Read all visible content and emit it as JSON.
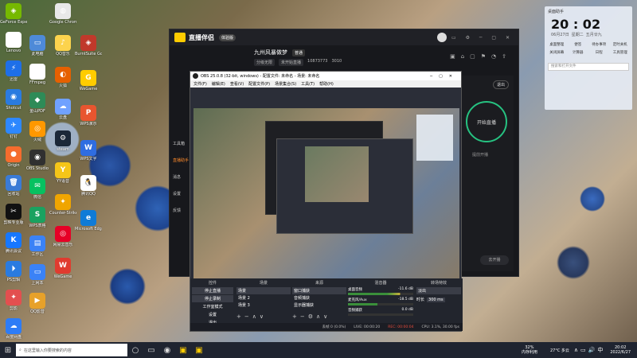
{
  "desktop": {
    "icons": [
      {
        "label": "GeForce Experience",
        "glyph": "◈",
        "bg": "#76b900"
      },
      {
        "label": "Lenovo",
        "glyph": "▣",
        "bg": "#ffffff"
      },
      {
        "label": "迅雷",
        "glyph": "⚡",
        "bg": "#1e6fe8"
      },
      {
        "label": "Shotcut",
        "glyph": "◉",
        "bg": "#2a7be0"
      },
      {
        "label": "钉钉",
        "glyph": "✈",
        "bg": "#2d88ff"
      },
      {
        "label": "Origin",
        "glyph": "●",
        "bg": "#f56c2d"
      },
      {
        "label": "回收站",
        "glyph": "🗑",
        "bg": "#3a7bd5"
      },
      {
        "label": "剪映专业版",
        "glyph": "✂",
        "bg": "#111111"
      },
      {
        "label": "腾讯会议",
        "glyph": "K",
        "bg": "#1677ff"
      },
      {
        "label": "PS剪辑",
        "glyph": "⏵",
        "bg": "#2a7be0"
      },
      {
        "label": "剪影",
        "glyph": "✦",
        "bg": "#e34f4f"
      },
      {
        "label": "百度网盘",
        "glyph": "☁",
        "bg": "#2d7cf6"
      }
    ],
    "icons_col2": [
      {
        "label": "此电脑",
        "glyph": "▭",
        "bg": "#4e8ad8"
      },
      {
        "label": "FFmpeg",
        "glyph": "▲",
        "bg": "#ffffff"
      },
      {
        "label": "金山PDF",
        "glyph": "◆",
        "bg": "#2e8b57"
      },
      {
        "label": "火绒",
        "glyph": "◎",
        "bg": "#ff9800"
      },
      {
        "label": "OBS Studio",
        "glyph": "◉",
        "bg": "#303030"
      },
      {
        "label": "微信",
        "glyph": "✉",
        "bg": "#07c160"
      },
      {
        "label": "WPS表格",
        "glyph": "S",
        "bg": "#1aa260"
      },
      {
        "label": "工作区",
        "glyph": "▤",
        "bg": "#3b82f6"
      },
      {
        "label": "上网本",
        "glyph": "▭",
        "bg": "#3b82f6"
      },
      {
        "label": "QQ影音",
        "glyph": "▶",
        "bg": "#e7a12a"
      }
    ],
    "icons_col3": [
      {
        "label": "Google Chrome",
        "glyph": "◍",
        "bg": "#e8e8e8"
      },
      {
        "label": "QQ音乐",
        "glyph": "♪",
        "bg": "#fcd34d"
      },
      {
        "label": "火狐",
        "glyph": "◐",
        "bg": "#e66000"
      },
      {
        "label": "云盘",
        "glyph": "☁",
        "bg": "#70a1ff"
      },
      {
        "label": "steam",
        "glyph": "⚙",
        "bg": "#1b2838"
      },
      {
        "label": "YY语音",
        "glyph": "Y",
        "bg": "#f5c518"
      },
      {
        "label": "Counter-Strike Global Offensive",
        "glyph": "✦",
        "bg": "#f0a500"
      },
      {
        "label": "网易云音乐",
        "glyph": "◎",
        "bg": "#e60026"
      },
      {
        "label": "WeGame",
        "glyph": "W",
        "bg": "#e03b2f"
      }
    ],
    "icons_col4": [
      {
        "label": "BurntSuite Go",
        "glyph": "◈",
        "bg": "#c0392b"
      },
      {
        "label": "WeGame",
        "glyph": "G",
        "bg": "#ffcc00"
      },
      {
        "label": "WPS演示",
        "glyph": "P",
        "bg": "#e8552f"
      },
      {
        "label": "WPS文字",
        "glyph": "W",
        "bg": "#2f6de1"
      },
      {
        "label": "腾讯QQ",
        "glyph": "🐧",
        "bg": "#ffffff"
      },
      {
        "label": "Microsoft Edge",
        "glyph": "e",
        "bg": "#0f7bd7"
      }
    ]
  },
  "live_app": {
    "name": "直播伴侣",
    "badge": "体验版",
    "title": "九州风暴做梦",
    "tag": "普通",
    "sub1": "分级无限",
    "sub2": "未开始直播",
    "stat1": "10873773",
    "stat2": "3010",
    "side_labels": [
      "工具箱",
      "直播助手",
      "消息",
      "设置",
      "反馈"
    ],
    "cta_label": "开始直播",
    "sub_label": "提前开播"
  },
  "obs": {
    "window_title": "OBS 25.0.8 (32-bit, windows) - 配置文件: 未命名 - 场景: 未命名",
    "menu": [
      "文件(F)",
      "编辑(E)",
      "查看(V)",
      "配置文件(P)",
      "场景集合(S)",
      "工具(T)",
      "帮助(H)"
    ],
    "panels": {
      "controls_title": "控件",
      "scenes_title": "场景",
      "sources_title": "来源",
      "mixer_title": "混音器",
      "transitions_title": "转场特效"
    },
    "controls": [
      "停止直播",
      "停止录制",
      "工作室模式",
      "设置",
      "退出"
    ],
    "scenes": [
      "场景",
      "场景 2",
      "场景 3"
    ],
    "sources": [
      "窗口捕获",
      "音频捕获",
      "显示器捕获"
    ],
    "mixer": [
      {
        "name": "桌面音频",
        "db": "-11.6 dB"
      },
      {
        "name": "麦克风/Aux",
        "db": "-18.5 dB"
      },
      {
        "name": "音频捕获",
        "db": "0.0 dB"
      }
    ],
    "transition": "淡出",
    "duration_label": "时长",
    "duration": "300 ms",
    "status": {
      "dropped": "丢帧 0 (0.0%)",
      "live": "LIVE: 00:00:20",
      "rec": "REC: 00:00:04",
      "cpu": "CPU: 3.1%, 30.00 fps"
    }
  },
  "clock": {
    "time": "20 : 02",
    "date": "06月27日",
    "weekday": "星期二",
    "lunar": "五月廿九",
    "items": [
      "桌面整理",
      "便签",
      "待办事项",
      "定时关机",
      "关闭屏幕",
      "计算器",
      "日程",
      "工具管理"
    ],
    "search_placeholder": "搜索和打开文件"
  },
  "taskbar": {
    "search_placeholder": "在这里输入你要搜索的内容",
    "weather": "27°C 多云",
    "memory": "32%",
    "memory_label": "内存利用",
    "time": "20:02",
    "date": "2022/6/27"
  }
}
